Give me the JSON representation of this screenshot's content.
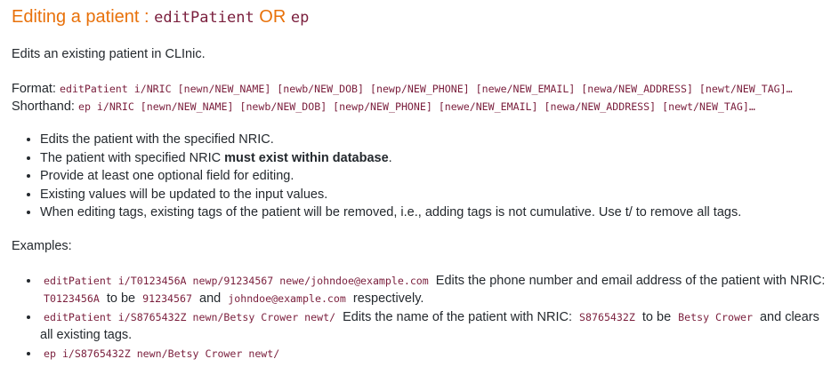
{
  "heading": {
    "text": "Editing a patient : ",
    "cmd": "editPatient",
    "or": " OR ",
    "short": "ep"
  },
  "intro": "Edits an existing patient in CLInic.",
  "format": {
    "label": "Format: ",
    "value": "editPatient i/NRIC [newn/NEW_NAME] [newb/NEW_DOB] [newp/NEW_PHONE] [newe/NEW_EMAIL] [newa/NEW_ADDRESS] [newt/NEW_TAG]…",
    "short_label": "Shorthand: ",
    "short_value": "ep i/NRIC [newn/NEW_NAME] [newb/NEW_DOB] [newp/NEW_PHONE] [newe/NEW_EMAIL] [newa/NEW_ADDRESS] [newt/NEW_TAG]…"
  },
  "notes": {
    "n1": "Edits the patient with the specified NRIC.",
    "n2_pre": "The patient with specified NRIC ",
    "n2_bold": "must exist within database",
    "n2_post": ".",
    "n3": "Provide at least one optional field for editing.",
    "n4": "Existing values will be updated to the input values.",
    "n5": "When editing tags, existing tags of the patient will be removed, i.e., adding tags is not cumulative. Use t/ to remove all tags."
  },
  "examples_label": "Examples:",
  "examples": {
    "e1_cmd": "editPatient i/T0123456A newp/91234567 newe/johndoe@example.com",
    "e1_t1": "Edits the phone number and email address of the patient with NRIC:",
    "e1_c1": "T0123456A",
    "e1_t2": "to be",
    "e1_c2": "91234567",
    "e1_t3": "and",
    "e1_c3": "johndoe@example.com",
    "e1_t4": "respectively.",
    "e2_cmd": "editPatient i/S8765432Z newn/Betsy Crower newt/",
    "e2_t1": "Edits the name of the patient with NRIC:",
    "e2_c1": "S8765432Z",
    "e2_t2": "to be",
    "e2_c2": "Betsy Crower",
    "e2_t3": "and clears all existing tags.",
    "e3_cmd": "ep i/S8765432Z newn/Betsy Crower newt/"
  }
}
